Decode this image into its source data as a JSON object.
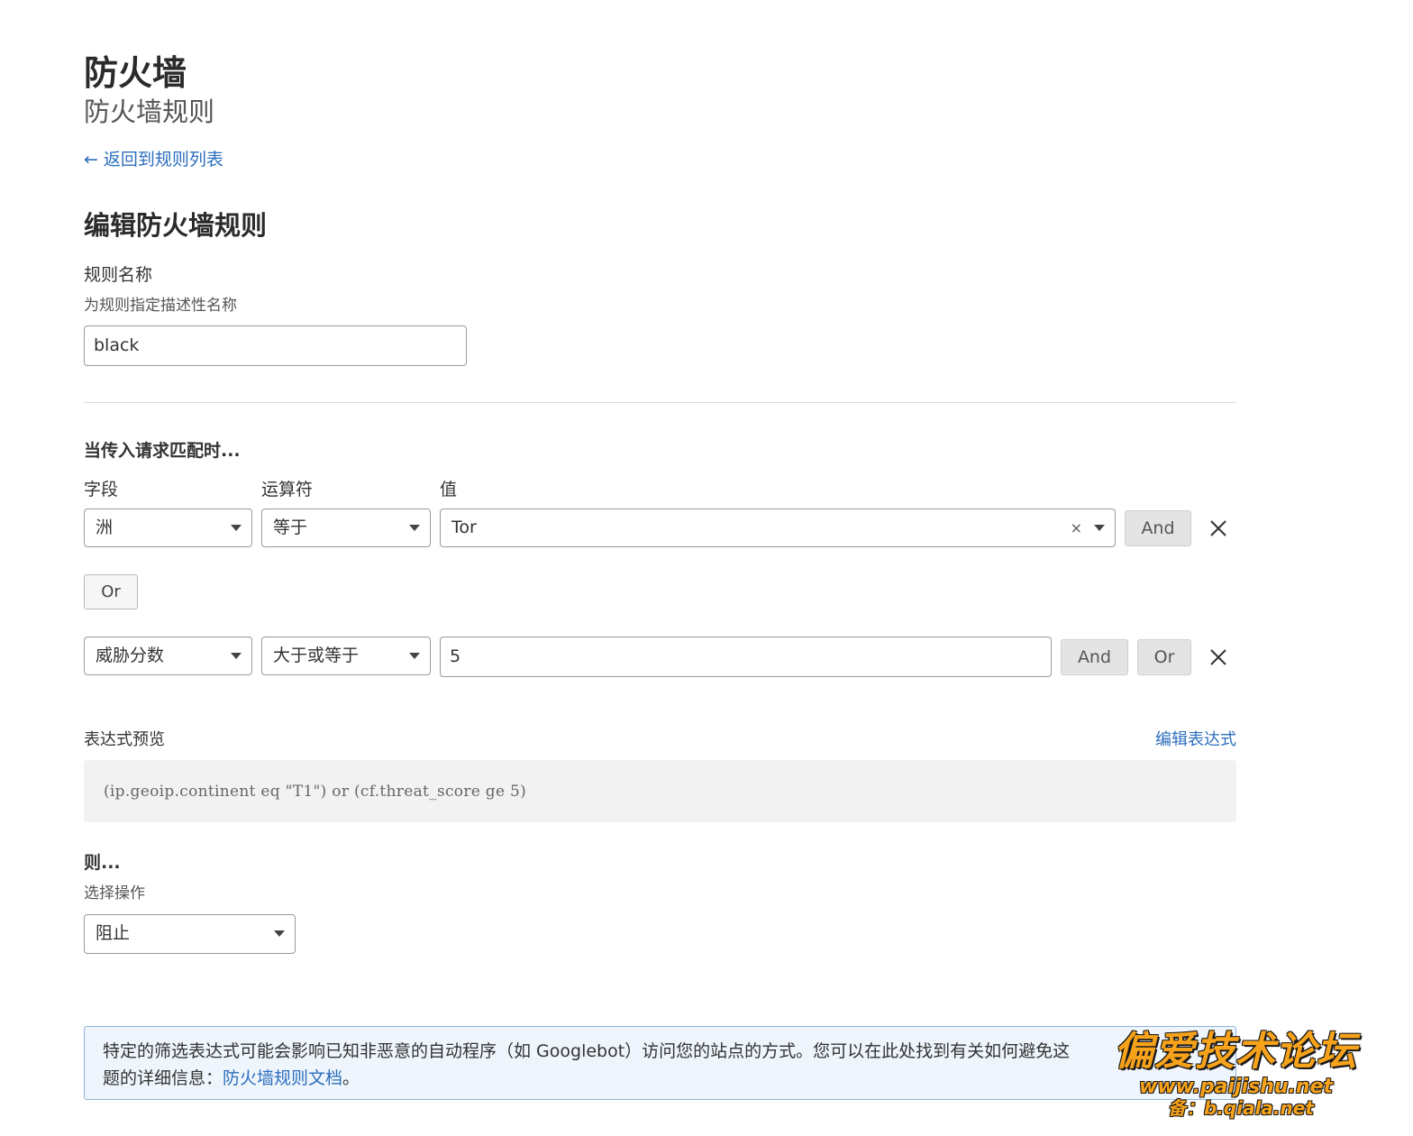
{
  "header": {
    "title": "防火墙",
    "subtitle": "防火墙规则",
    "back_link": "返回到规则列表",
    "back_arrow": "←"
  },
  "form": {
    "title": "编辑防火墙规则",
    "rule_name_label": "规则名称",
    "rule_name_help": "为规则指定描述性名称",
    "rule_name_value": "black"
  },
  "conditions": {
    "heading": "当传入请求匹配时...",
    "col_field": "字段",
    "col_operator": "运算符",
    "col_value": "值",
    "rows": [
      {
        "field": "洲",
        "operator": "等于",
        "value": "Tor",
        "clear": "×",
        "and_label": "And"
      },
      {
        "field": "威胁分数",
        "operator": "大于或等于",
        "value": "5",
        "and_label": "And",
        "or_label": "Or"
      }
    ],
    "or_between_label": "Or"
  },
  "preview": {
    "label": "表达式预览",
    "edit_link": "编辑表达式",
    "expression": "(ip.geoip.continent eq \"T1\") or (cf.threat_score ge 5)"
  },
  "action": {
    "heading": "则...",
    "label": "选择操作",
    "selected": "阻止"
  },
  "notice": {
    "text": "特定的筛选表达式可能会影响已知非恶意的自动程序（如 Googlebot）访问您的站点的方式。您可以在此处找到有关如何避免这",
    "text2": "题的详细信息：",
    "link": "防火墙规则文档",
    "end": "。"
  },
  "watermark": {
    "main": "偏爱技术论坛",
    "url": "www.paijishu.net",
    "sub": "备：b.qiala.net"
  },
  "colors": {
    "link": "#2c6ebd",
    "notice_bg": "#eef5fc",
    "watermark": "#f7a21b"
  }
}
